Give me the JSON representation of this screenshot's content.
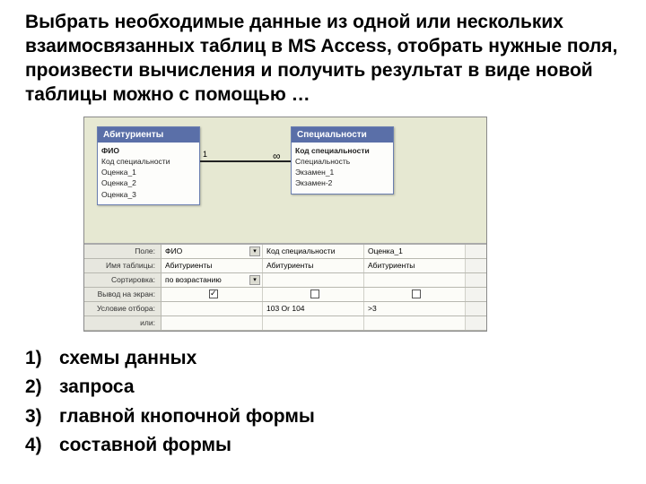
{
  "question": "Выбрать необходимые данные из одной или нескольких взаимосвязанных таблиц в MS Access, отобрать нужные поля, произвести вычисления и получить результат в виде новой таблицы можно с помощью …",
  "diagram": {
    "table_left": {
      "title": "Абитуриенты",
      "fields": [
        "ФИО",
        "Код специальности",
        "Оценка_1",
        "Оценка_2",
        "Оценка_3"
      ]
    },
    "table_right": {
      "title": "Специальности",
      "fields": [
        "Код специальности",
        "Специальность",
        "Экзамен_1",
        "Экзамен-2"
      ]
    },
    "rel_left": "1",
    "rel_right": "∞"
  },
  "grid": {
    "labels": {
      "field": "Поле:",
      "table": "Имя таблицы:",
      "sort": "Сортировка:",
      "show": "Вывод на экран:",
      "crit": "Условие отбора:",
      "or": "или:"
    },
    "cols": [
      {
        "field": "ФИО",
        "table": "Абитуриенты",
        "sort": "по возрастанию",
        "show": true,
        "crit": ""
      },
      {
        "field": "Код специальности",
        "table": "Абитуриенты",
        "sort": "",
        "show": false,
        "crit": "103 Or 104"
      },
      {
        "field": "Оценка_1",
        "table": "Абитуриенты",
        "sort": "",
        "show": false,
        "crit": ">3"
      }
    ]
  },
  "answers": [
    {
      "n": "1)",
      "t": "схемы данных"
    },
    {
      "n": "2)",
      "t": "запроса"
    },
    {
      "n": "3)",
      "t": "главной кнопочной формы"
    },
    {
      "n": "4)",
      "t": "составной формы"
    }
  ]
}
